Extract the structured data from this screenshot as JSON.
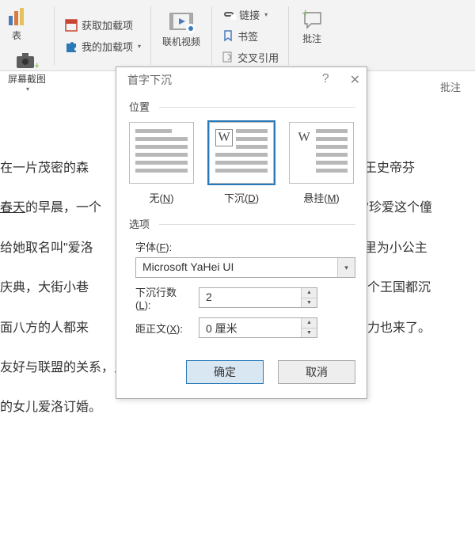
{
  "ribbon": {
    "chart_label": "表",
    "screenshot_label": "屏幕截图",
    "get_addins_label": "获取加载项",
    "my_addins_label": "我的加载项",
    "online_video_label": "联机视频",
    "link_label": "链接",
    "bookmark_label": "书签",
    "crossref_label": "交叉引用",
    "comment_label": "批注",
    "comment_label2": "批注"
  },
  "dialog": {
    "title": "首字下沉",
    "help": "?",
    "position_label": "位置",
    "pos_none": "无(",
    "pos_none_key": "N",
    "pos_dropped": "下沉(",
    "pos_dropped_key": "D",
    "pos_margin": "悬挂(",
    "pos_margin_key": "M",
    "options_label": "选项",
    "font_label": "字体(",
    "font_key": "F",
    "font_value": "Microsoft YaHei UI",
    "lines_label": "下沉行数(",
    "lines_key": "L",
    "lines_value": "2",
    "dist_label": "距正文(",
    "dist_key": "X",
    "dist_value": "0 厘米",
    "ok": "确定",
    "cancel": "取消"
  },
  "doc": {
    "p1a": "在一片茂密的森",
    "p1b": "住着国王史帝芬",
    "p2a": "春天",
    "p2b": "的早晨，一个",
    "p2c": "后非常珍爱这个僮",
    "p3a": "给她取名叫\"爱洛",
    "p3b": "王宫里为小公主",
    "p4a": "庆典，大街小巷",
    "p4b": "，整个王国都沉",
    "p5a": "面八方的人都来",
    "p5b": "忆菲力也来了。",
    "p6": "友好与联盟的关系，史帝芬国王宣布哈伯的儿子、王国的继承人菲",
    "p7": "的女儿爱洛订婚。"
  }
}
